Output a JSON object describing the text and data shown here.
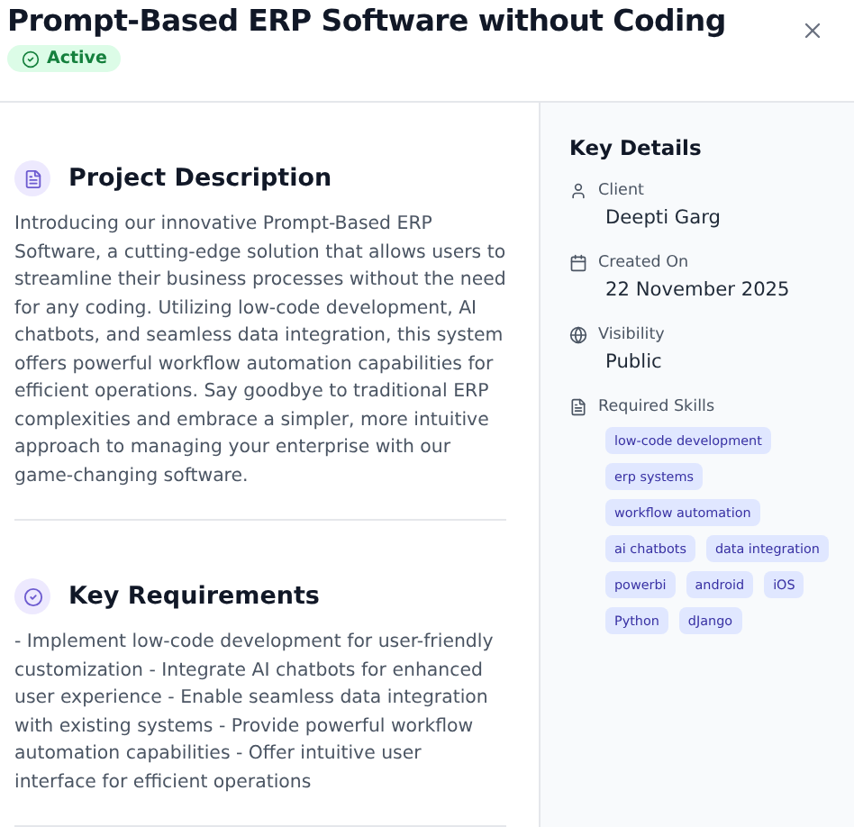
{
  "header": {
    "title": "Prompt-Based ERP Software without Coding",
    "status": {
      "label": "Active",
      "kind": "active"
    }
  },
  "sections": [
    {
      "title": "Project Description",
      "text": "Introducing our innovative Prompt-Based ERP Software, a cutting-edge solution that allows users to streamline their business processes without the need for any coding. Utilizing low-code development, AI chatbots, and seamless data integration, this system offers powerful workflow automation capabilities for efficient operations. Say goodbye to traditional ERP complexities and embrace a simpler, more intuitive approach to managing your enterprise with our game-changing software."
    },
    {
      "title": "Key Requirements",
      "text": "- Implement low-code development for user-friendly customization - Integrate AI chatbots for enhanced user experience - Enable seamless data integration with existing systems - Provide powerful workflow automation capabilities - Offer intuitive user interface for efficient operations"
    }
  ],
  "key_details": {
    "title": "Key Details",
    "items": [
      {
        "label": "Client",
        "value": "Deepti Garg"
      },
      {
        "label": "Created On",
        "value": "22 November 2025"
      },
      {
        "label": "Visibility",
        "value": "Public"
      }
    ],
    "skills": {
      "label": "Required Skills",
      "tags": [
        "low-code development",
        "erp systems",
        "workflow automation",
        "ai chatbots",
        "data integration",
        "powerbi",
        "android",
        "iOS",
        "Python",
        "dJango"
      ]
    }
  }
}
